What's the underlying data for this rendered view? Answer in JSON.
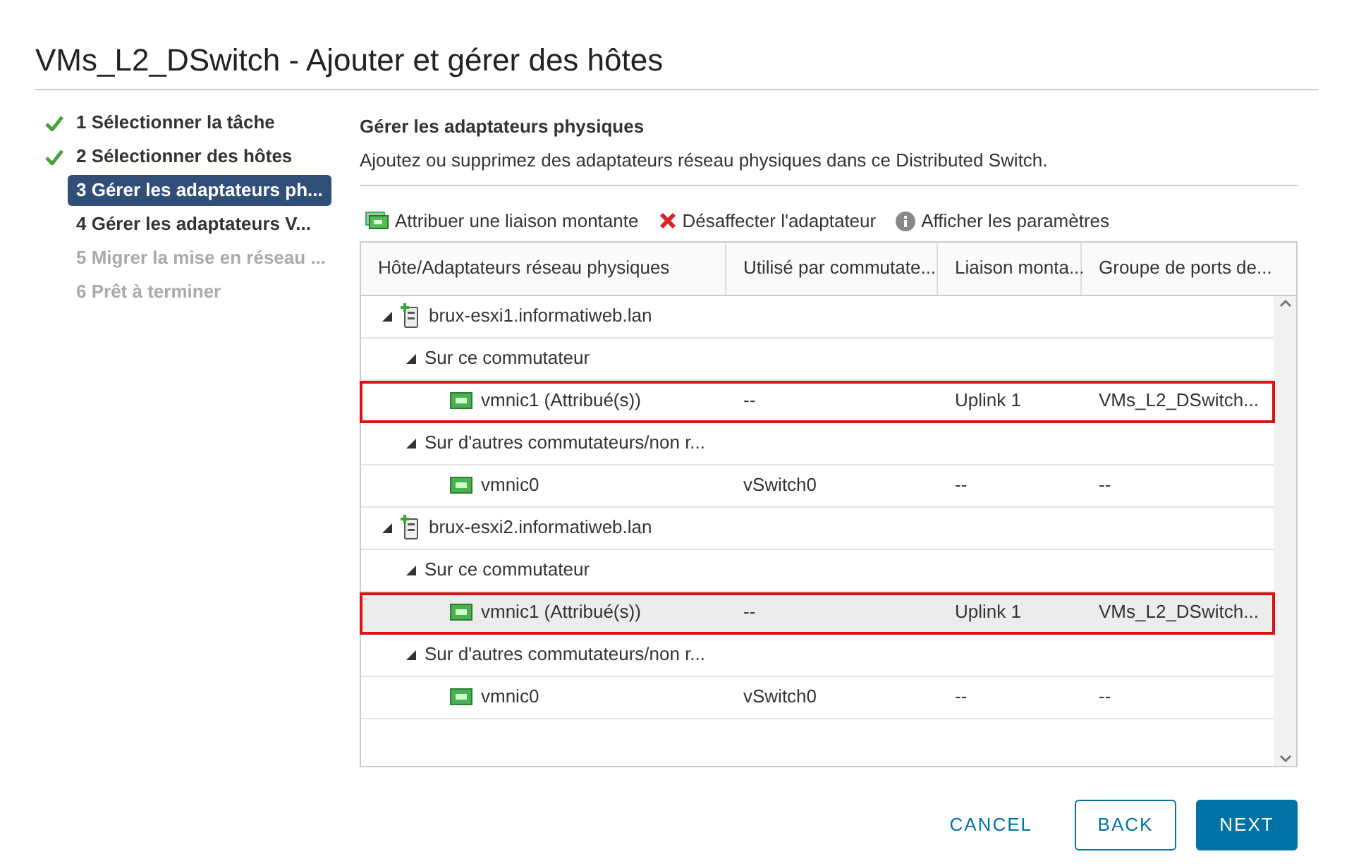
{
  "dialog": {
    "title": "VMs_L2_DSwitch - Ajouter et gérer des hôtes"
  },
  "steps": [
    {
      "label": "1 Sélectionner la tâche",
      "done": true,
      "selected": false,
      "disabled": false
    },
    {
      "label": "2 Sélectionner des hôtes",
      "done": true,
      "selected": false,
      "disabled": false
    },
    {
      "label": "3 Gérer les adaptateurs ph...",
      "done": false,
      "selected": true,
      "disabled": false
    },
    {
      "label": "4 Gérer les adaptateurs V...",
      "done": false,
      "selected": false,
      "disabled": false
    },
    {
      "label": "5 Migrer la mise en réseau ...",
      "done": false,
      "selected": false,
      "disabled": true
    },
    {
      "label": "6 Prêt à terminer",
      "done": false,
      "selected": false,
      "disabled": true
    }
  ],
  "section": {
    "title": "Gérer les adaptateurs physiques",
    "description": "Ajoutez ou supprimez des adaptateurs réseau physiques dans ce Distributed Switch."
  },
  "toolbar": [
    {
      "kind": "assign",
      "label": "Attribuer une liaison montante"
    },
    {
      "kind": "remove",
      "label": "Désaffecter l'adaptateur"
    },
    {
      "kind": "info",
      "label": "Afficher les paramètres"
    }
  ],
  "table": {
    "columns": [
      "Hôte/Adaptateurs réseau physiques",
      "Utilisé par commutate...",
      "Liaison monta...",
      "Groupe de ports de..."
    ],
    "rows": [
      {
        "kind": "host",
        "name": "brux-esxi1.informatiweb.lan",
        "expanded": true,
        "children": [
          {
            "kind": "group",
            "name": "Sur ce commutateur",
            "expanded": true,
            "children": [
              {
                "kind": "adapter",
                "name": "vmnic1 (Attribué(s))",
                "switch": "--",
                "uplink": "Uplink 1",
                "port_group": "VMs_L2_DSwitch...",
                "selected": false,
                "highlighted": true
              }
            ]
          },
          {
            "kind": "group",
            "name": "Sur d'autres commutateurs/non r...",
            "expanded": true,
            "children": [
              {
                "kind": "adapter",
                "name": "vmnic0",
                "switch": "vSwitch0",
                "uplink": "--",
                "port_group": "--",
                "selected": false,
                "highlighted": false
              }
            ]
          }
        ]
      },
      {
        "kind": "host",
        "name": "brux-esxi2.informatiweb.lan",
        "expanded": true,
        "children": [
          {
            "kind": "group",
            "name": "Sur ce commutateur",
            "expanded": true,
            "children": [
              {
                "kind": "adapter",
                "name": "vmnic1 (Attribué(s))",
                "switch": "--",
                "uplink": "Uplink 1",
                "port_group": "VMs_L2_DSwitch...",
                "selected": true,
                "highlighted": true
              }
            ]
          },
          {
            "kind": "group",
            "name": "Sur d'autres commutateurs/non r...",
            "expanded": true,
            "children": [
              {
                "kind": "adapter",
                "name": "vmnic0",
                "switch": "vSwitch0",
                "uplink": "--",
                "port_group": "--",
                "selected": false,
                "highlighted": false
              }
            ]
          }
        ]
      }
    ]
  },
  "buttons": [
    {
      "kind": "link",
      "label": "CANCEL"
    },
    {
      "kind": "outline",
      "label": "BACK"
    },
    {
      "kind": "primary",
      "label": "NEXT"
    }
  ]
}
